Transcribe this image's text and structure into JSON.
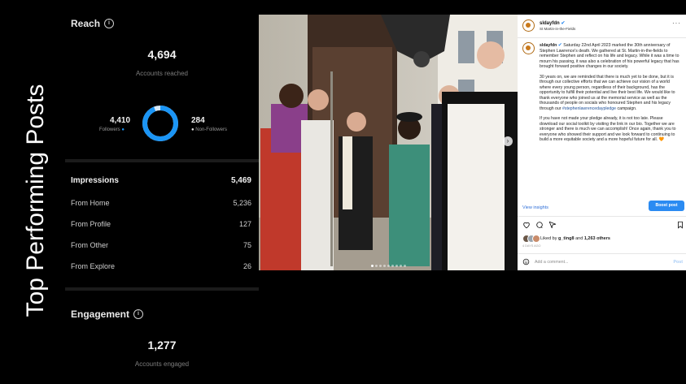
{
  "slide": {
    "side_title": "Top Performing Posts"
  },
  "reach": {
    "title": "Reach",
    "accounts_reached": "4,694",
    "accounts_reached_label": "Accounts reached",
    "followers_value": "4,410",
    "followers_label": "Followers",
    "non_followers_value": "284",
    "non_followers_label": "Non-Followers",
    "followers_share": 0.94,
    "follower_color": "#1b95f5",
    "non_follower_color": "#d9e9f8"
  },
  "impressions": {
    "title": "Impressions",
    "total": "5,469",
    "rows": [
      {
        "label": "From Home",
        "value": "5,236"
      },
      {
        "label": "From Profile",
        "value": "127"
      },
      {
        "label": "From Other",
        "value": "75"
      },
      {
        "label": "From Explore",
        "value": "26"
      }
    ]
  },
  "engagement": {
    "title": "Engagement",
    "accounts_engaged": "1,277",
    "accounts_engaged_label": "Accounts engaged"
  },
  "post": {
    "username": "sldayfdn",
    "location": "St Martin-in-the-Fields",
    "caption_p1": "Saturday 22nd April 2023 marked the 30th anniversary of Stephen Lawrence's death. We gathered at St. Martin-in-the-fields to remember Stephen and reflect on his life and legacy. While it was a time to mourn his passing, it was also a celebration of his powerful legacy that has brought forward positive changes in our society.",
    "caption_p2_pre": "30 years on, we are reminded that there is much yet to be done, but it is through our collective efforts that we can achieve our vision of a world where every young person, regardless of their background, has the opportunity to fulfill their potential and live their best life. We would like to thank everyone who joined us at the memorial service as well as the thousands of people on socials who honoured Stephen and his legacy through our ",
    "caption_p2_tag": "#stephenlawrencedaypledge",
    "caption_p2_post": " campaign.",
    "caption_p3": "If you have not made your pledge already, it is not too late. Please download our social toolkit by visiting the link in our bio. Together we are stronger and there is much we can accomplish! Once again, thank you to everyone who showed their support and we look forward to continuing to build a more equitable society and a more hopeful future for all. 🧡",
    "view_insights": "View insights",
    "boost_post": "Boost post",
    "liked_by_prefix": "Liked by ",
    "liked_by_user": "g_ting8",
    "liked_by_middle": " and ",
    "liked_by_others": "1,263 others",
    "time_ago": "4 DAYS AGO",
    "comment_placeholder": "Add a comment...",
    "post_label": "Post",
    "carousel_slides": 9,
    "carousel_active": 0
  },
  "icons": {
    "info": "info-icon",
    "heart": "heart-icon",
    "comment": "comment-icon",
    "share": "share-icon",
    "bookmark": "bookmark-icon",
    "smile": "emoji-icon",
    "next": "chevron-right-icon",
    "more": "more-icon"
  }
}
